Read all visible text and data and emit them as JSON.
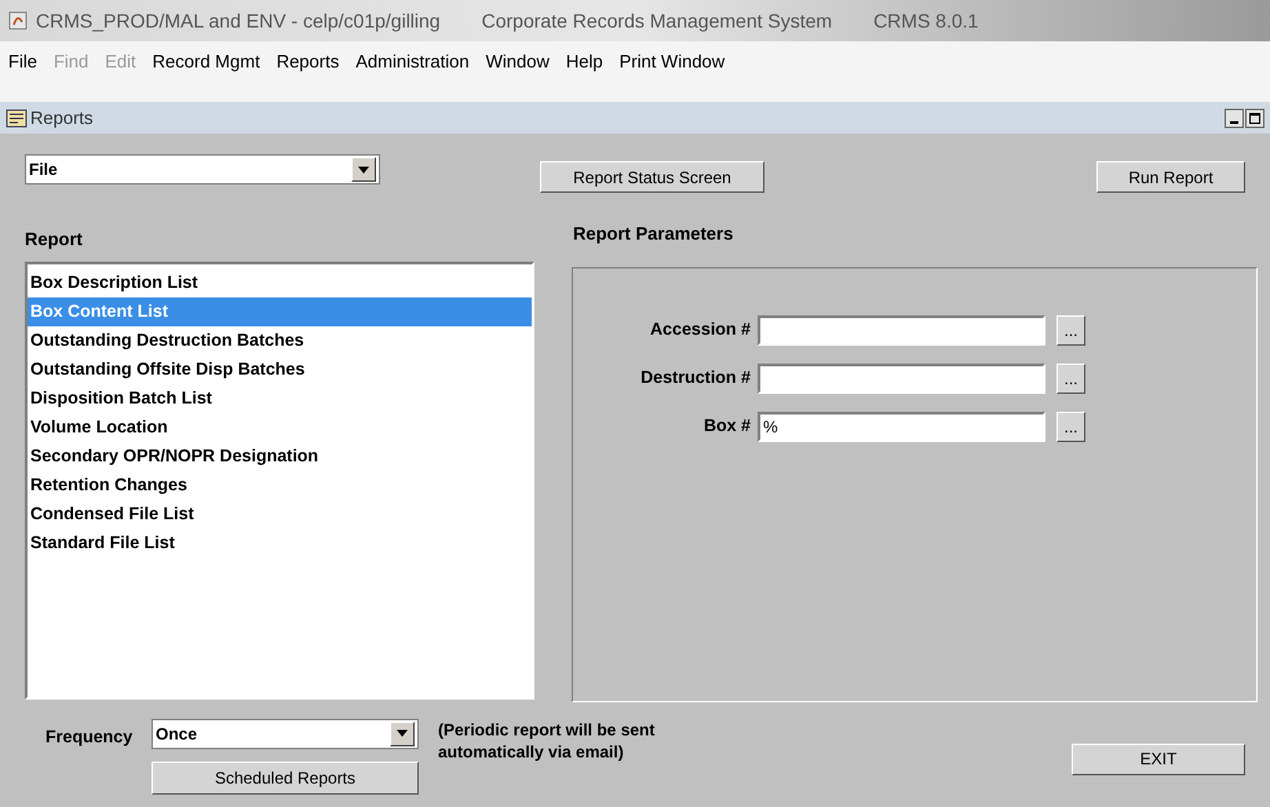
{
  "window": {
    "title": "CRMS_PROD/MAL and ENV - celp/c01p/gilling",
    "subtitle": "Corporate Records Management System",
    "version": "CRMS 8.0.1"
  },
  "menu": [
    {
      "label": "File",
      "disabled": false
    },
    {
      "label": "Find",
      "disabled": true
    },
    {
      "label": "Edit",
      "disabled": true
    },
    {
      "label": "Record Mgmt",
      "disabled": false
    },
    {
      "label": "Reports",
      "disabled": false
    },
    {
      "label": "Administration",
      "disabled": false
    },
    {
      "label": "Window",
      "disabled": false
    },
    {
      "label": "Help",
      "disabled": false
    },
    {
      "label": "Print Window",
      "disabled": false
    }
  ],
  "inner_window": {
    "title": "Reports"
  },
  "category_select": {
    "value": "File"
  },
  "report_status_button": "Report Status Screen",
  "run_report_button": "Run Report",
  "report_list": {
    "label": "Report",
    "items": [
      {
        "label": "Box Description List",
        "selected": false
      },
      {
        "label": "Box Content List",
        "selected": true
      },
      {
        "label": "Outstanding Destruction Batches",
        "selected": false
      },
      {
        "label": "Outstanding Offsite Disp Batches",
        "selected": false
      },
      {
        "label": "Disposition Batch List",
        "selected": false
      },
      {
        "label": "Volume Location",
        "selected": false
      },
      {
        "label": "Secondary OPR/NOPR Designation",
        "selected": false
      },
      {
        "label": "Retention Changes",
        "selected": false
      },
      {
        "label": "Condensed File List",
        "selected": false
      },
      {
        "label": "Standard File List",
        "selected": false
      }
    ]
  },
  "parameters": {
    "title": "Report Parameters",
    "fields": [
      {
        "label": "Accession #",
        "lookup": "..."
      },
      {
        "label": "Destruction #",
        "lookup": "..."
      },
      {
        "label": "Box #",
        "value": "%",
        "lookup": "..."
      }
    ]
  },
  "frequency": {
    "label": "Frequency",
    "value": "Once",
    "note": "(Periodic report will be sent automatically via email)"
  },
  "scheduled_reports_button": "Scheduled Reports",
  "exit_button": "EXIT"
}
